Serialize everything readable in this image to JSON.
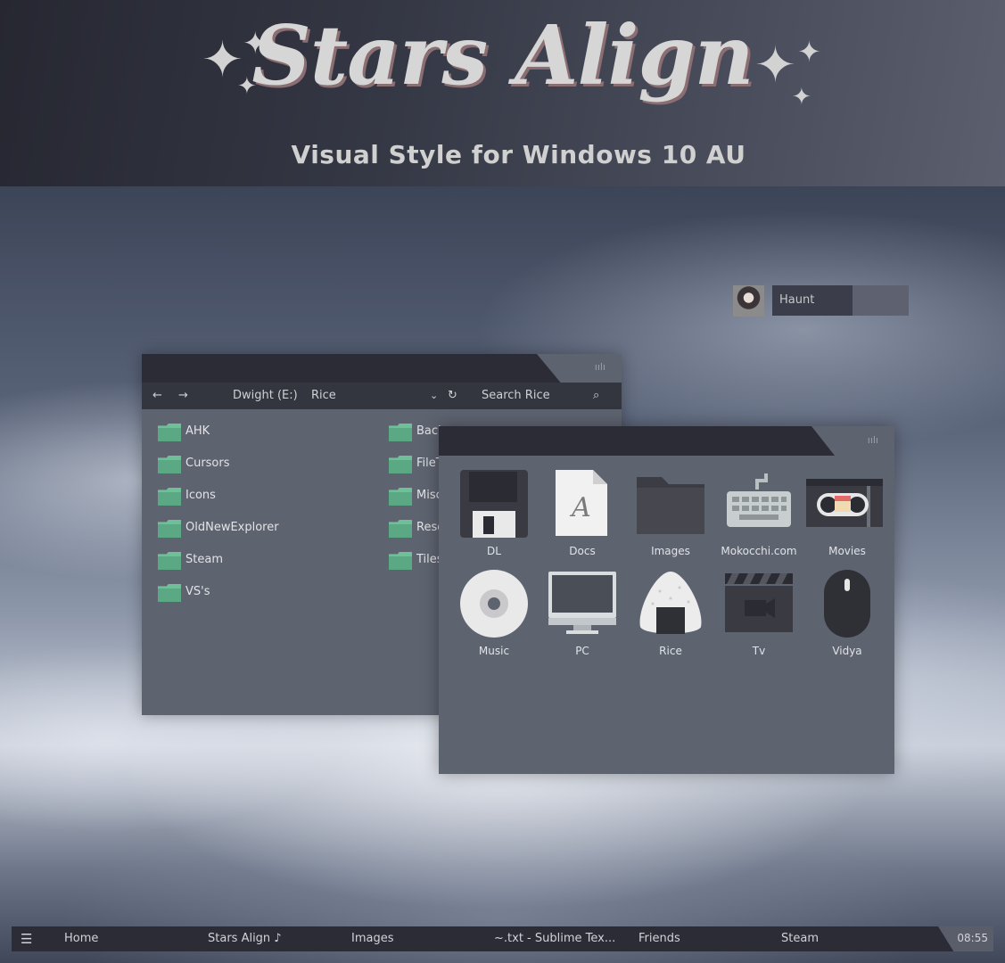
{
  "banner": {
    "title": "Stars Align",
    "subtitle": "Visual Style for Windows 10 AU"
  },
  "user": {
    "name": "Haunt"
  },
  "explorer1": {
    "nav": {
      "drive": "Dwight (E:)",
      "folder": "Rice",
      "search_placeholder": "Search Rice"
    },
    "folders_left": [
      "AHK",
      "Cursors",
      "Icons",
      "OldNewExplorer",
      "Steam",
      "VS's"
    ],
    "folders_right": [
      "Back",
      "FileT",
      "Misc",
      "Reso",
      "Tiles"
    ]
  },
  "explorer2": {
    "tiles": [
      {
        "label": "DL",
        "icon": "floppy-icon"
      },
      {
        "label": "Docs",
        "icon": "document-icon"
      },
      {
        "label": "Images",
        "icon": "folder-icon"
      },
      {
        "label": "Mokocchi.com",
        "icon": "keyboard-icon"
      },
      {
        "label": "Movies",
        "icon": "vhs-icon"
      },
      {
        "label": "Music",
        "icon": "cd-icon"
      },
      {
        "label": "PC",
        "icon": "monitor-icon"
      },
      {
        "label": "Rice",
        "icon": "onigiri-icon"
      },
      {
        "label": "Tv",
        "icon": "clapperboard-icon"
      },
      {
        "label": "Vidya",
        "icon": "mouse-icon"
      }
    ]
  },
  "taskbar": {
    "items": [
      "Home",
      "Stars Align ♪",
      "Images",
      "~.txt - Sublime Tex...",
      "Friends",
      "Steam"
    ],
    "clock": "08:55"
  },
  "colors": {
    "banner_dark": "#262731",
    "window_body": "#5e6370",
    "title_bar": "#2b2c36",
    "folder_green": "#6fbf98"
  }
}
